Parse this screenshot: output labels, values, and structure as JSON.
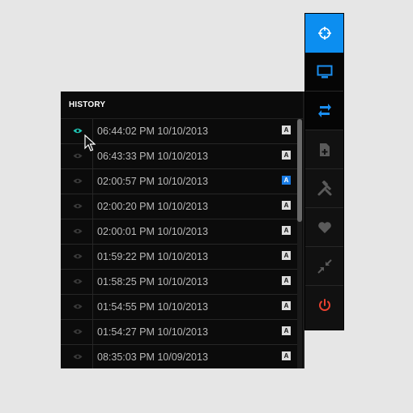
{
  "history": {
    "title": "HISTORY",
    "rows": [
      {
        "time": "06:44:02 PM 10/10/2013",
        "badge": "A",
        "badge_active": false,
        "eye_active": true
      },
      {
        "time": "06:43:33 PM 10/10/2013",
        "badge": "A",
        "badge_active": false,
        "eye_active": false
      },
      {
        "time": "02:00:57 PM 10/10/2013",
        "badge": "A",
        "badge_active": true,
        "eye_active": false
      },
      {
        "time": "02:00:20 PM 10/10/2013",
        "badge": "A",
        "badge_active": false,
        "eye_active": false
      },
      {
        "time": "02:00:01 PM 10/10/2013",
        "badge": "A",
        "badge_active": false,
        "eye_active": false
      },
      {
        "time": "01:59:22 PM 10/10/2013",
        "badge": "A",
        "badge_active": false,
        "eye_active": false
      },
      {
        "time": "01:58:25 PM 10/10/2013",
        "badge": "A",
        "badge_active": false,
        "eye_active": false
      },
      {
        "time": "01:54:55 PM 10/10/2013",
        "badge": "A",
        "badge_active": false,
        "eye_active": false
      },
      {
        "time": "01:54:27 PM 10/10/2013",
        "badge": "A",
        "badge_active": false,
        "eye_active": false
      },
      {
        "time": "08:35:03 PM 10/09/2013",
        "badge": "A",
        "badge_active": false,
        "eye_active": false
      }
    ]
  },
  "toolbar": {
    "items": [
      {
        "icon": "crosshair-icon",
        "state": "active"
      },
      {
        "icon": "monitor-icon",
        "state": "highlighted"
      },
      {
        "icon": "sync-arrows-icon",
        "state": "highlighted"
      },
      {
        "icon": "add-document-icon",
        "state": "normal"
      },
      {
        "icon": "tools-icon",
        "state": "normal"
      },
      {
        "icon": "heart-icon",
        "state": "normal"
      },
      {
        "icon": "collapse-arrows-icon",
        "state": "normal"
      },
      {
        "icon": "power-icon",
        "state": "normal"
      }
    ]
  },
  "colors": {
    "accent": "#0c8ef0",
    "eye_active": "#1fc4b4",
    "power": "#e8402f",
    "icon_inactive": "#5a5a5a"
  }
}
